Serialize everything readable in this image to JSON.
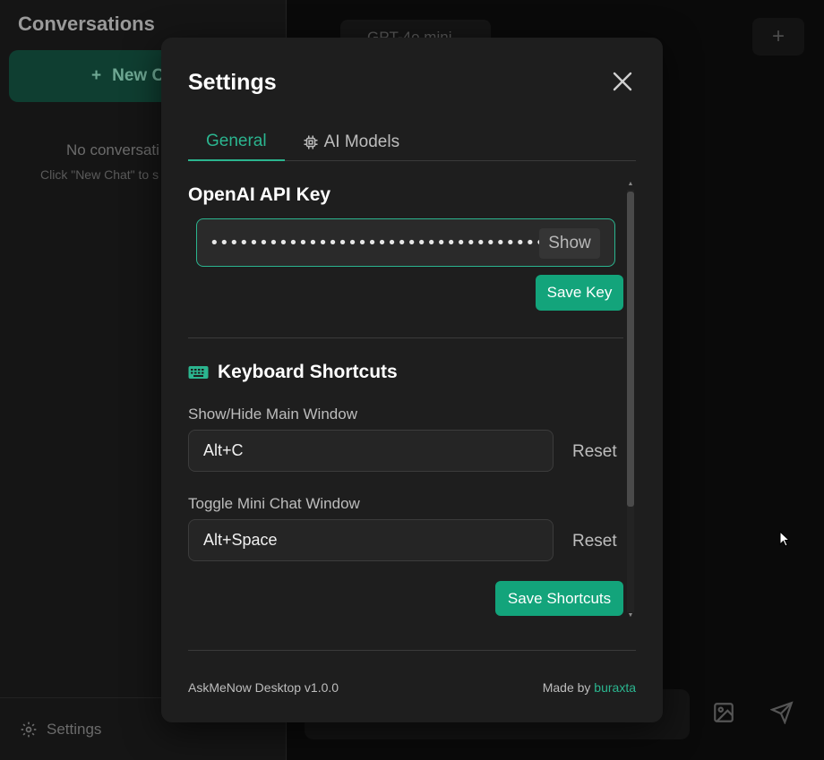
{
  "background": {
    "sidebar_title": "Conversations",
    "new_chat_label": "New C",
    "empty_title": "No conversati",
    "empty_subtitle": "Click \"New Chat\" to s",
    "settings_label": "Settings",
    "model_label": "GPT-4o mini"
  },
  "modal": {
    "title": "Settings",
    "tabs": [
      {
        "label": "General",
        "active": true
      },
      {
        "label": "AI Models",
        "active": false,
        "icon": "chip-icon"
      }
    ],
    "api": {
      "section_title": "OpenAI API Key",
      "masked_value": "•••••••••••••••••••••••••••••••••••••••••••••••••••",
      "show_label": "Show",
      "save_label": "Save Key"
    },
    "shortcuts": {
      "section_title": "Keyboard Shortcuts",
      "icon": "keyboard-icon",
      "items": [
        {
          "label": "Show/Hide Main Window",
          "value": "Alt+C",
          "reset_label": "Reset"
        },
        {
          "label": "Toggle Mini Chat Window",
          "value": "Alt+Space",
          "reset_label": "Reset"
        }
      ],
      "save_label": "Save Shortcuts"
    },
    "footer": {
      "version": "AskMeNow Desktop v1.0.0",
      "made_by_prefix": "Made by",
      "author": "buraxta"
    }
  },
  "colors": {
    "accent": "#2bb58f",
    "button": "#13a47b",
    "modal_bg": "#1e1e1e"
  }
}
